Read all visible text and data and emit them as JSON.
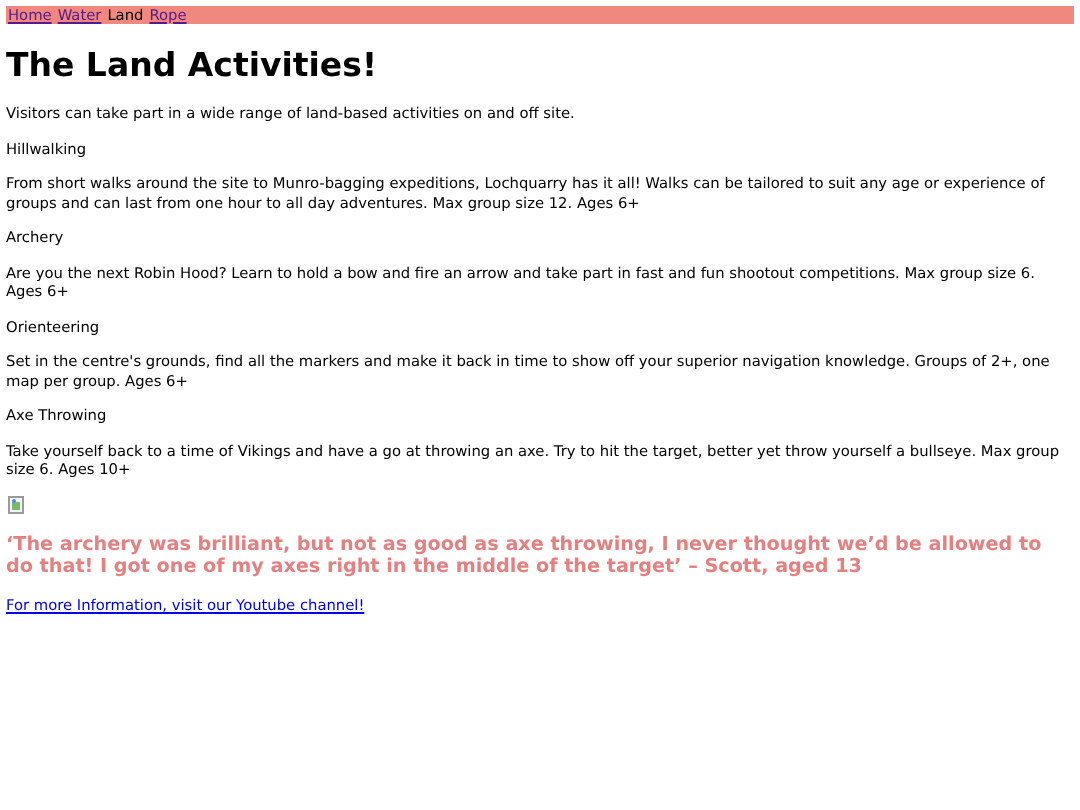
{
  "nav": [
    {
      "label": "Home",
      "selected": false
    },
    {
      "label": "Water",
      "selected": false
    },
    {
      "label": "Land",
      "selected": true
    },
    {
      "label": "Rope",
      "selected": false
    }
  ],
  "title": "The Land Activities!",
  "intro": "Visitors can take part in a wide range of land-based activities on and off site.",
  "activities": [
    {
      "name": "Hillwalking",
      "description": "From short walks around the site to Munro-bagging expeditions, Lochquarry has it all! Walks can be tailored to suit any age or experience of groups and can last from one hour to all day adventures. Max group size 12. Ages 6+"
    },
    {
      "name": "Archery",
      "description": "Are you the next Robin Hood? Learn to hold a bow and fire an arrow and take part in fast and fun shootout competitions. Max group size 6. Ages 6+"
    },
    {
      "name": "Orienteering",
      "description": "Set in the centre's grounds, find all the markers and make it back in time to show off your superior navigation knowledge. Groups of 2+, one map per group. Ages 6+"
    },
    {
      "name": "Axe Throwing",
      "description": "Take yourself back to a time of Vikings and have a go at throwing an axe. Try to hit the target, better yet throw yourself a bullseye. Max group size 6. Ages 10+"
    }
  ],
  "quote": "‘The archery was brilliant, but not as good as axe throwing, I never thought we’d be allowed to do that! I got one of my axes right in the middle of the target’ – Scott, aged 13",
  "link": "For more Information, visit our Youtube channel!"
}
